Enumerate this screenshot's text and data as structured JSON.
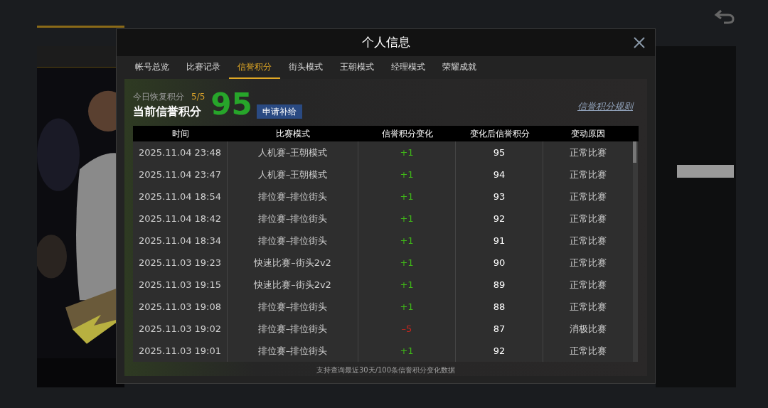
{
  "dialog": {
    "title": "个人信息"
  },
  "tabs": [
    {
      "label": "帐号总览",
      "selected": false
    },
    {
      "label": "比赛记录",
      "selected": false
    },
    {
      "label": "信誉积分",
      "selected": true
    },
    {
      "label": "街头模式",
      "selected": false
    },
    {
      "label": "王朝模式",
      "selected": false
    },
    {
      "label": "经理模式",
      "selected": false
    },
    {
      "label": "荣耀成就",
      "selected": false
    }
  ],
  "summary": {
    "recovery_label": "今日恢复积分",
    "recovery_value": "5/5",
    "score_label": "当前信誉积分",
    "score": "95",
    "apply_button": "申请补给",
    "rules_link": "信誉积分规则"
  },
  "table": {
    "columns": [
      "时间",
      "比赛模式",
      "信誉积分变化",
      "变化后信誉积分",
      "变动原因"
    ],
    "rows": [
      {
        "time": "2025.11.04  23:48",
        "mode": "人机赛–王朝模式",
        "change": "+1",
        "color": "#3fb618",
        "after": "95",
        "reason": "正常比赛"
      },
      {
        "time": "2025.11.04  23:47",
        "mode": "人机赛–王朝模式",
        "change": "+1",
        "color": "#3fb618",
        "after": "94",
        "reason": "正常比赛"
      },
      {
        "time": "2025.11.04  18:54",
        "mode": "排位赛–排位街头",
        "change": "+1",
        "color": "#3fb618",
        "after": "93",
        "reason": "正常比赛"
      },
      {
        "time": "2025.11.04  18:42",
        "mode": "排位赛–排位街头",
        "change": "+1",
        "color": "#3fb618",
        "after": "92",
        "reason": "正常比赛"
      },
      {
        "time": "2025.11.04  18:34",
        "mode": "排位赛–排位街头",
        "change": "+1",
        "color": "#3fb618",
        "after": "91",
        "reason": "正常比赛"
      },
      {
        "time": "2025.11.03  19:23",
        "mode": "快速比赛–街头2v2",
        "change": "+1",
        "color": "#3fb618",
        "after": "90",
        "reason": "正常比赛"
      },
      {
        "time": "2025.11.03  19:15",
        "mode": "快速比赛–街头2v2",
        "change": "+1",
        "color": "#3fb618",
        "after": "89",
        "reason": "正常比赛"
      },
      {
        "time": "2025.11.03  19:08",
        "mode": "排位赛–排位街头",
        "change": "+1",
        "color": "#3fb618",
        "after": "88",
        "reason": "正常比赛"
      },
      {
        "time": "2025.11.03  19:02",
        "mode": "排位赛–排位街头",
        "change": "–5",
        "color": "#c8271e",
        "after": "87",
        "reason": "消极比赛"
      },
      {
        "time": "2025.11.03  19:01",
        "mode": "排位赛–排位街头",
        "change": "+1",
        "color": "#3fb618",
        "after": "92",
        "reason": "正常比赛"
      }
    ]
  },
  "footer_note": "支持查询最近30天/100条信誉积分变化数据"
}
